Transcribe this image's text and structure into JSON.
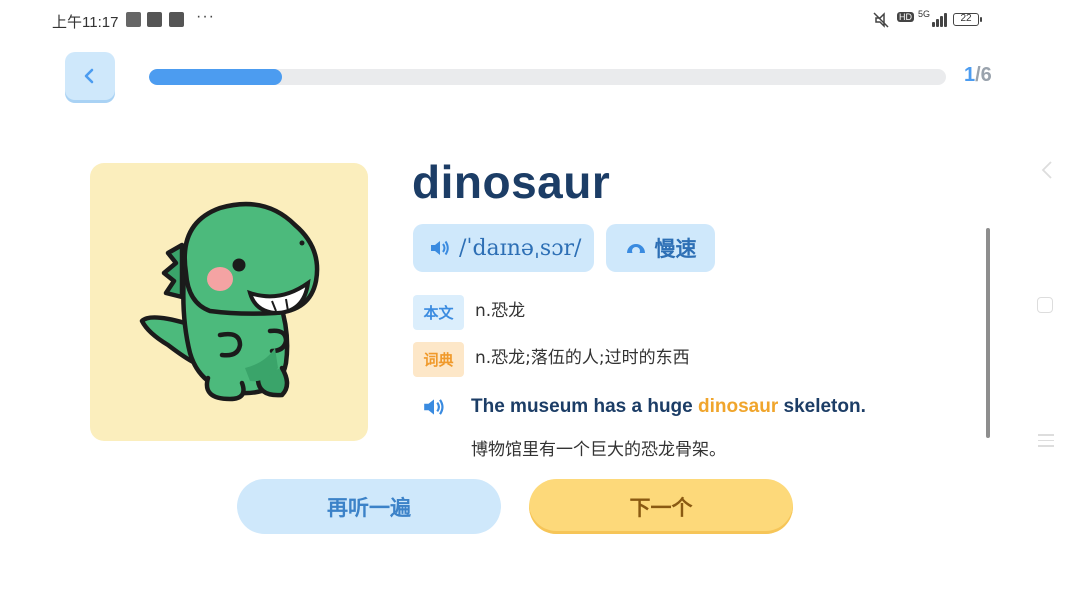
{
  "status_bar": {
    "time": "上午11:17",
    "network": "5G",
    "hd": "HD",
    "battery": "22"
  },
  "progress": {
    "current": "1",
    "total": "/6",
    "fraction": 0.167
  },
  "word": {
    "text": "dinosaur",
    "phonetic": "/ˈdaɪnəˌsɔr/",
    "slow_label": "慢速",
    "image_icon": "dinosaur-illustration"
  },
  "definitions": [
    {
      "tag": "本文",
      "text": "n.恐龙"
    },
    {
      "tag": "词典",
      "text": "n.恐龙;落伍的人;过时的东西"
    }
  ],
  "example": {
    "before": "The museum has a huge ",
    "highlight": "dinosaur",
    "after": " skeleton.",
    "translation": "博物馆里有一个巨大的恐龙骨架。"
  },
  "buttons": {
    "replay": "再听一遍",
    "next": "下一个"
  },
  "colors": {
    "accent_blue": "#4c9cf0",
    "word_navy": "#1c3d66",
    "highlight_orange": "#f0a52c",
    "card_bg": "#fbeebd",
    "next_btn": "#fdd97a"
  }
}
